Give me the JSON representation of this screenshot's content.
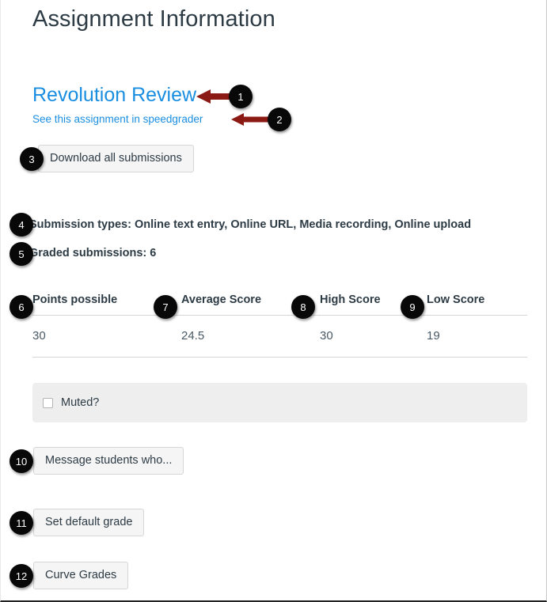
{
  "page": {
    "heading": "Assignment Information"
  },
  "links": {
    "assignment_title": "Revolution Review",
    "speedgrader": "See this assignment in speedgrader"
  },
  "buttons": {
    "download_all": "Download all submissions",
    "message_students": "Message students who...",
    "set_default_grade": "Set default grade",
    "curve_grades": "Curve Grades"
  },
  "info": {
    "submission_types": "Submission types: Online text entry, Online URL, Media recording, Online upload",
    "graded_submissions": "Graded submissions: 6"
  },
  "score_table": {
    "headers": [
      "Points possible",
      "Average Score",
      "High Score",
      "Low Score"
    ],
    "values": [
      "30",
      "24.5",
      "30",
      "19"
    ]
  },
  "muted": {
    "label": "Muted?",
    "checked": false
  },
  "callouts": [
    {
      "number": "1",
      "target": "assignment-title-link"
    },
    {
      "number": "2",
      "target": "speedgrader-link"
    },
    {
      "number": "3",
      "target": "download-all-submissions-button"
    },
    {
      "number": "4",
      "target": "submission-types-text"
    },
    {
      "number": "5",
      "target": "graded-submissions-text"
    },
    {
      "number": "6",
      "target": "points-possible-column"
    },
    {
      "number": "7",
      "target": "average-score-column"
    },
    {
      "number": "8",
      "target": "high-score-column"
    },
    {
      "number": "9",
      "target": "low-score-column"
    },
    {
      "number": "10",
      "target": "message-students-button"
    },
    {
      "number": "11",
      "target": "set-default-grade-button"
    },
    {
      "number": "12",
      "target": "curve-grades-button"
    }
  ],
  "colors": {
    "link": "#1a8ee0",
    "heading": "#2D3B45",
    "badge_bg": "#080808",
    "arrow": "#8B1A14",
    "panel_bg": "#eeeeee",
    "button_bg": "#f5f5f5"
  }
}
